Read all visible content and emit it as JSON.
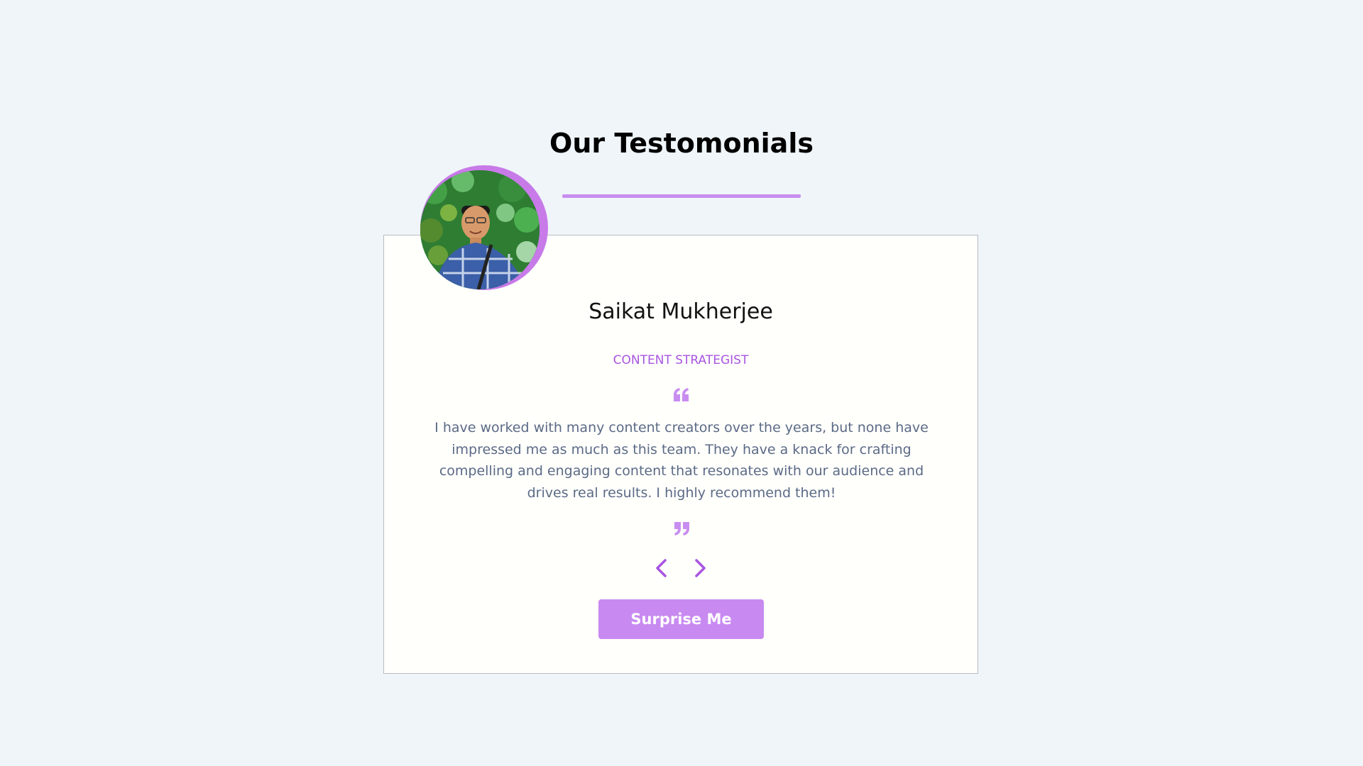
{
  "section": {
    "title": "Our Testomonials",
    "accent_color": "#c88df0"
  },
  "testimonial": {
    "name": "Saikat Mukherjee",
    "role": "CONTENT STRATEGIST",
    "text": "I have worked with many content creators over the years, but none have impressed me as much as this team. They have a knack for crafting compelling and engaging content that resonates with our audience and drives real results. I highly recommend them!",
    "avatar_icon": "person-photo-avatar",
    "open_quote_icon": "quote-open-icon",
    "close_quote_icon": "quote-close-icon"
  },
  "controls": {
    "prev_icon": "chevron-left-icon",
    "next_icon": "chevron-right-icon",
    "surprise_label": "Surprise Me",
    "button_color": "#c88af0"
  }
}
